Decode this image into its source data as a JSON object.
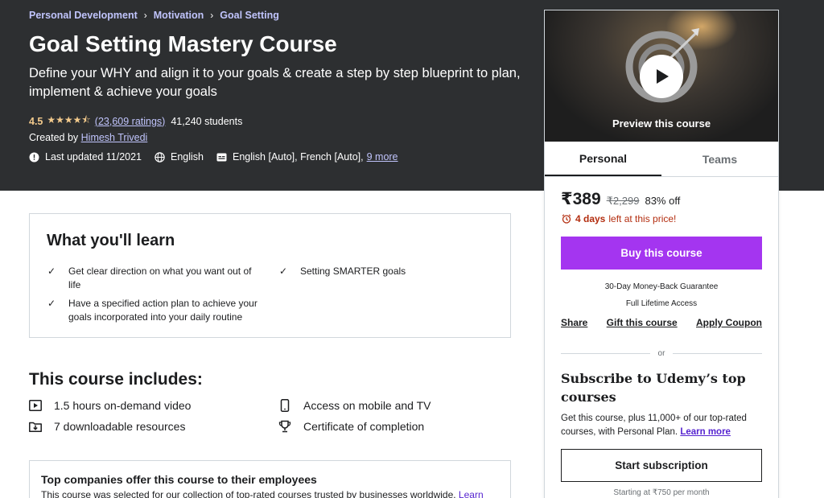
{
  "breadcrumb": [
    "Personal Development",
    "Motivation",
    "Goal Setting"
  ],
  "course": {
    "title": "Goal Setting Mastery Course",
    "subtitle": "Define your WHY and align it to your goals & create a step by step blueprint to plan, implement & achieve your goals",
    "rating": "4.5",
    "stars": "★★★★⯪",
    "rating_count": "(23,609 ratings)",
    "students": "41,240 students",
    "created_by_label": "Created by",
    "instructor": "Himesh Trivedi",
    "last_updated": "Last updated 11/2021",
    "language": "English",
    "captions": "English [Auto], French [Auto],",
    "captions_more": "9 more"
  },
  "learn": {
    "title": "What you'll learn",
    "check_icon": "✓",
    "items": [
      "Get clear direction on what you want out of life",
      "Have a specified action plan to achieve your goals incorporated into your daily routine",
      "Setting SMARTER goals"
    ]
  },
  "includes": {
    "title": "This course includes:",
    "items": [
      {
        "icon": "video-icon",
        "text": "1.5 hours on-demand video"
      },
      {
        "icon": "download-icon",
        "text": "7 downloadable resources"
      },
      {
        "icon": "mobile-icon",
        "text": "Access on mobile and TV"
      },
      {
        "icon": "trophy-icon",
        "text": "Certificate of completion"
      }
    ]
  },
  "business": {
    "title": "Top companies offer this course to their employees",
    "text": "This course was selected for our collection of top-rated courses trusted by businesses worldwide.",
    "link": "Learn"
  },
  "sidebar": {
    "preview_label": "Preview this course",
    "tabs": [
      "Personal",
      "Teams"
    ],
    "price": "₹389",
    "old_price": "₹2,299",
    "discount": "83% off",
    "timer_days": "4 days",
    "timer_text": "left at this price!",
    "buy_label": "Buy this course",
    "guarantee": "30-Day Money-Back Guarantee",
    "lifetime": "Full Lifetime Access",
    "links": [
      "Share",
      "Gift this course",
      "Apply Coupon"
    ],
    "or": "or",
    "subscribe_title": "Subscribe to Udemy’s top courses",
    "subscribe_text": "Get this course, plus 11,000+ of our top-rated courses, with Personal Plan.",
    "learn_more": "Learn more",
    "start_label": "Start subscription",
    "starting_at": "Starting at ₹750 per month"
  },
  "colors": {
    "header_bg": "#2d2f31",
    "accent_link": "#c0c4fc",
    "star": "#f3ca8c",
    "buy_button": "#a435f0",
    "timer": "#b32d0f",
    "link": "#5624d0"
  }
}
